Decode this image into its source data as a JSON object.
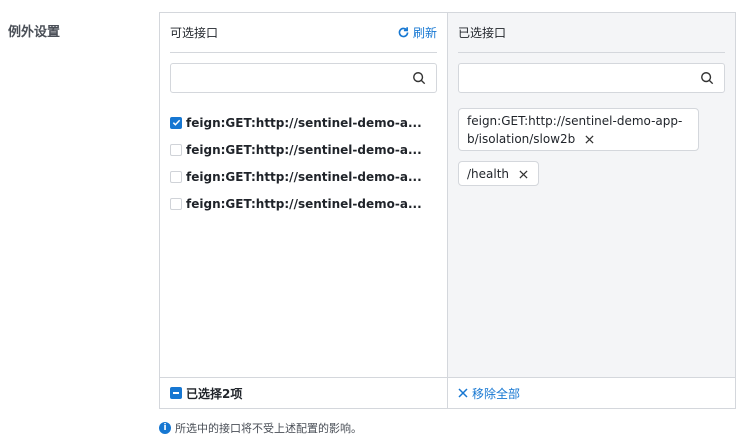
{
  "section_label": "例外设置",
  "left_pane": {
    "title": "可选接口",
    "refresh_label": "刷新",
    "search_placeholder": "",
    "items": [
      {
        "label": "feign:GET:http://sentinel-demo-a...",
        "checked": true
      },
      {
        "label": "feign:GET:http://sentinel-demo-a...",
        "checked": false
      },
      {
        "label": "feign:GET:http://sentinel-demo-a...",
        "checked": false
      },
      {
        "label": "feign:GET:http://sentinel-demo-a...",
        "checked": false
      }
    ],
    "footer_label": "已选择2项"
  },
  "right_pane": {
    "title": "已选接口",
    "search_placeholder": "",
    "tags": [
      {
        "label": "feign:GET:http://sentinel-demo-app-b/isolation/slow2b"
      },
      {
        "label": "/health"
      }
    ],
    "remove_all_label": "移除全部"
  },
  "hint_text": "所选中的接口将不受上述配置的影响。",
  "colors": {
    "accent": "#1677d2",
    "border": "#d4d7dc",
    "right_bg": "#f4f5f7"
  },
  "icons": {
    "refresh": "refresh-icon",
    "search": "search-icon",
    "close": "close-icon",
    "info": "info-icon"
  }
}
